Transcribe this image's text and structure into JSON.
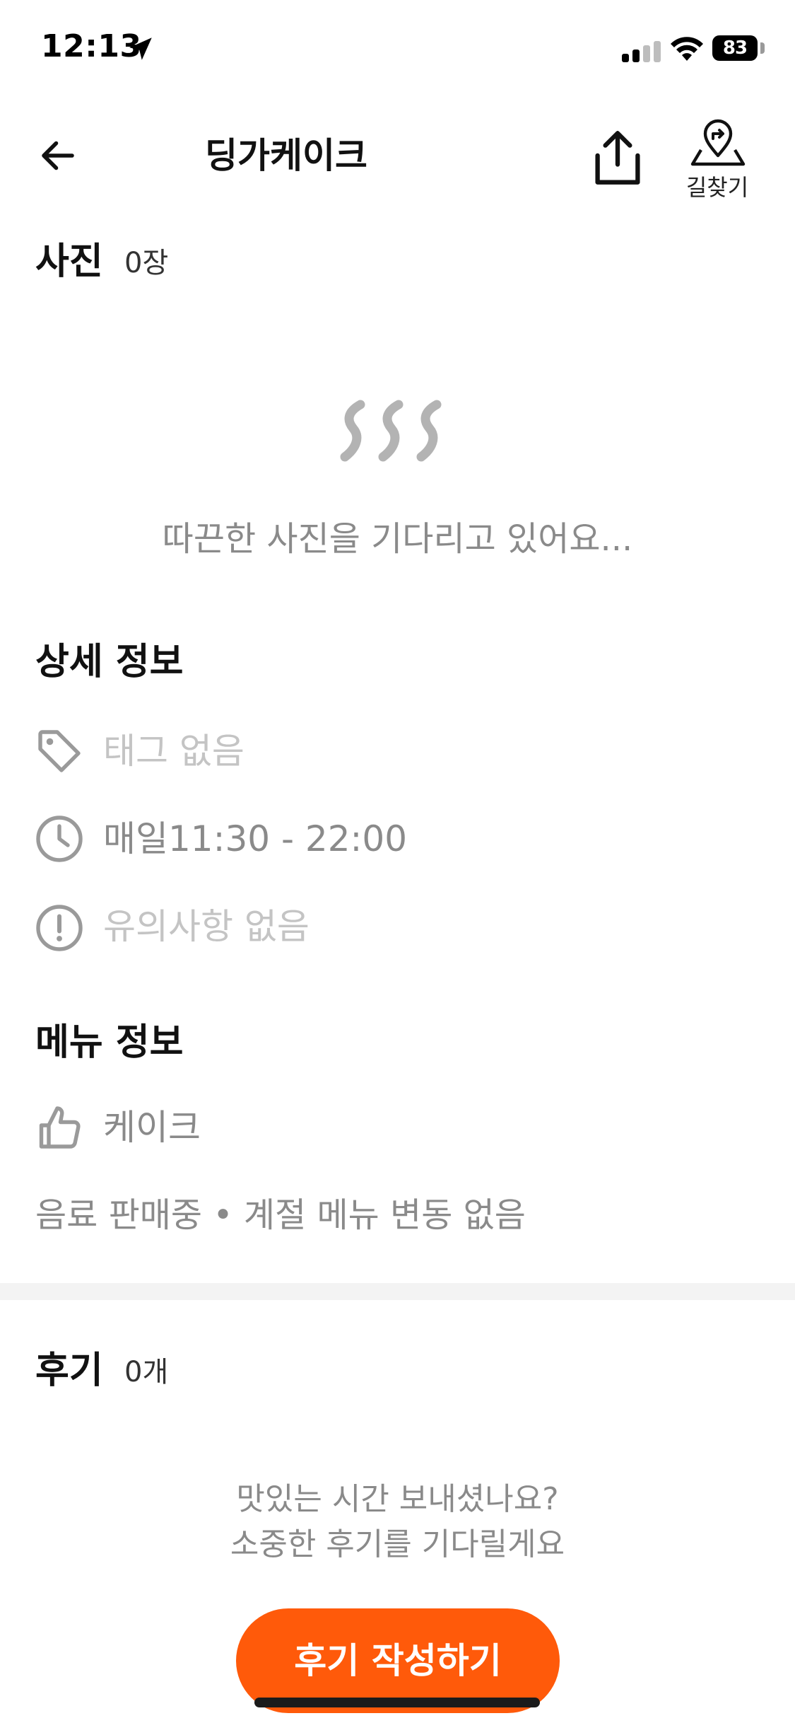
{
  "status_bar": {
    "time": "12:13",
    "battery": "83"
  },
  "header": {
    "title": "딩가케이크",
    "directions_label": "길찾기"
  },
  "photos": {
    "title": "사진",
    "count": "0장",
    "empty_text": "따끈한 사진을 기다리고 있어요..."
  },
  "details": {
    "title": "상세 정보",
    "tags": "태그 없음",
    "hours": "매일11:30 - 22:00",
    "notice": "유의사항 없음"
  },
  "menu": {
    "title": "메뉴 정보",
    "recommended": "케이크",
    "summary": "음료 판매중 • 계절 메뉴 변동 없음"
  },
  "reviews": {
    "title": "후기",
    "count": "0개",
    "empty_line1": "맛있는 시간 보내셨나요?",
    "empty_line2": "소중한 후기를 기다릴게요",
    "write_button": "후기 작성하기"
  },
  "colors": {
    "accent": "#ff5a0a",
    "muted_text": "#c4c4c4",
    "secondary_text": "#8a8a8a"
  }
}
